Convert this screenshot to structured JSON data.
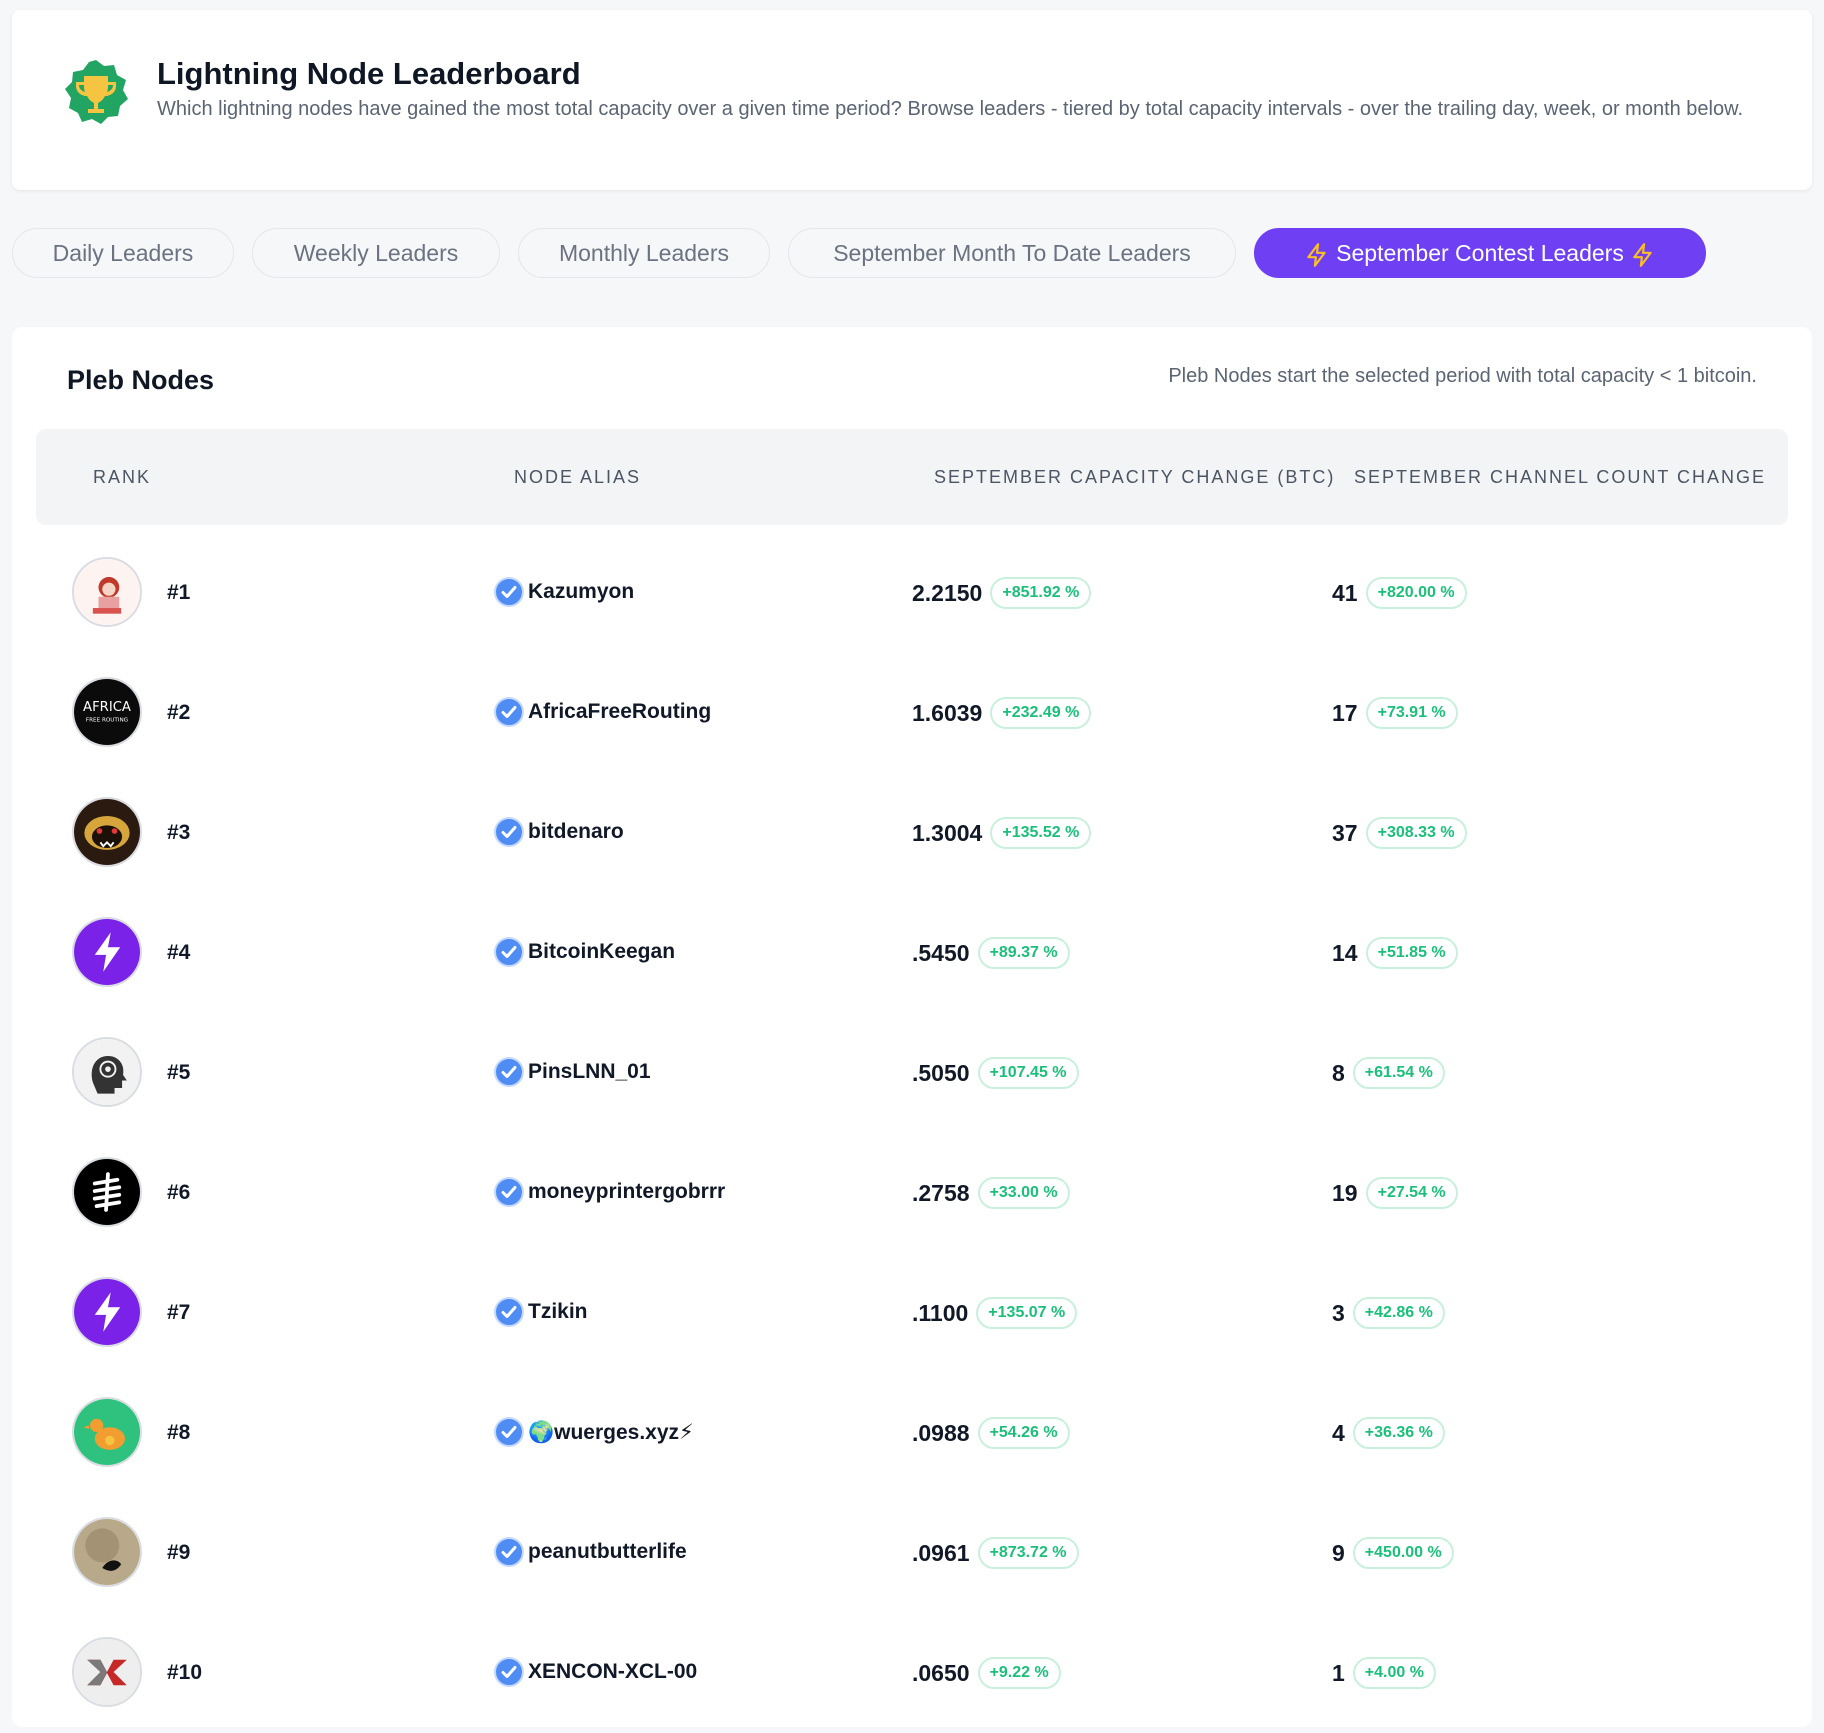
{
  "header": {
    "title": "Lightning Node Leaderboard",
    "description": "Which lightning nodes have gained the most total capacity over a given time period? Browse leaders - tiered by total capacity intervals - over the trailing day, week, or month below."
  },
  "tabs": [
    {
      "label": "Daily Leaders",
      "active": false
    },
    {
      "label": "Weekly Leaders",
      "active": false
    },
    {
      "label": "Monthly Leaders",
      "active": false
    },
    {
      "label": "September Month To Date Leaders",
      "active": false
    },
    {
      "label": "September Contest Leaders",
      "active": true
    }
  ],
  "section": {
    "title": "Pleb Nodes",
    "note": "Pleb Nodes start the selected period with total capacity < 1 bitcoin."
  },
  "columns": {
    "rank": "RANK",
    "alias": "NODE ALIAS",
    "capacity": "SEPTEMBER CAPACITY CHANGE (BTC)",
    "channels": "SEPTEMBER CHANNEL COUNT CHANGE"
  },
  "colors": {
    "accent": "#6e3ff3",
    "positive": "#1bbf7a",
    "verified": "#4f8df5"
  },
  "rows": [
    {
      "rank": "#1",
      "alias": "Kazumyon",
      "capacity": "2.2150",
      "capacity_pct": "+851.92 %",
      "channels": "41",
      "channels_pct": "+820.00 %",
      "avatar": "anime-avatar"
    },
    {
      "rank": "#2",
      "alias": "AfricaFreeRouting",
      "capacity": "1.6039",
      "capacity_pct": "+232.49 %",
      "channels": "17",
      "channels_pct": "+73.91 %",
      "avatar": "africa-logo",
      "avatar_text": "AFRICA",
      "avatar_subtext": "FREE ROUTING"
    },
    {
      "rank": "#3",
      "alias": "bitdenaro",
      "capacity": "1.3004",
      "capacity_pct": "+135.52 %",
      "channels": "37",
      "channels_pct": "+308.33 %",
      "avatar": "honey-badger"
    },
    {
      "rank": "#4",
      "alias": "BitcoinKeegan",
      "capacity": ".5450",
      "capacity_pct": "+89.37 %",
      "channels": "14",
      "channels_pct": "+51.85 %",
      "avatar": "lightning-bolt"
    },
    {
      "rank": "#5",
      "alias": "PinsLNN_01",
      "capacity": ".5050",
      "capacity_pct": "+107.45 %",
      "channels": "8",
      "channels_pct": "+61.54 %",
      "avatar": "head-gear"
    },
    {
      "rank": "#6",
      "alias": "moneyprintergobrrr",
      "capacity": ".2758",
      "capacity_pct": "+33.00 %",
      "channels": "19",
      "channels_pct": "+27.54 %",
      "avatar": "stripes-logo"
    },
    {
      "rank": "#7",
      "alias": "Tzikin",
      "capacity": ".1100",
      "capacity_pct": "+135.07 %",
      "channels": "3",
      "channels_pct": "+42.86 %",
      "avatar": "lightning-bolt"
    },
    {
      "rank": "#8",
      "alias": "🌍wuerges.xyz⚡",
      "capacity": ".0988",
      "capacity_pct": "+54.26 %",
      "channels": "4",
      "channels_pct": "+36.36 %",
      "avatar": "bird-logo"
    },
    {
      "rank": "#9",
      "alias": "peanutbutterlife",
      "capacity": ".0961",
      "capacity_pct": "+873.72 %",
      "channels": "9",
      "channels_pct": "+450.00 %",
      "avatar": "peanut-photo"
    },
    {
      "rank": "#10",
      "alias": "XENCON-XCL-00",
      "capacity": ".0650",
      "capacity_pct": "+9.22 %",
      "channels": "1",
      "channels_pct": "+4.00 %",
      "avatar": "x-logo"
    }
  ]
}
